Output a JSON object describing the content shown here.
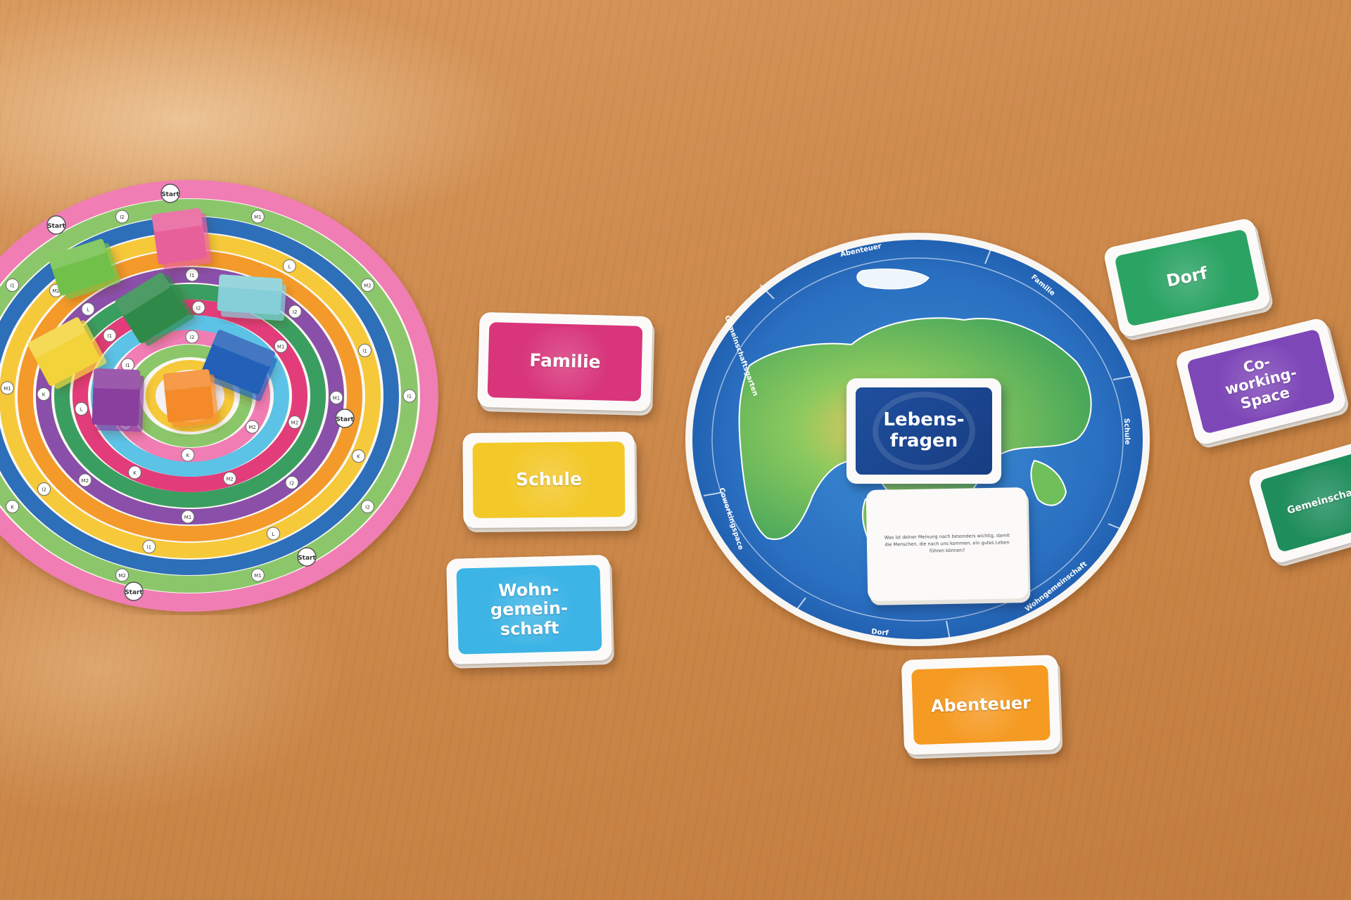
{
  "spiral_board": {
    "start_label": "Start",
    "field_labels": [
      "I1",
      "I2",
      "M1",
      "M2",
      "K",
      "L"
    ],
    "colors": [
      "#f07db3",
      "#8bc76a",
      "#2d6fb8",
      "#f6c93a",
      "#f39a2a",
      "#8a4fa8",
      "#3b9e61",
      "#e23d7a",
      "#5cc3e6"
    ]
  },
  "blocks": [
    {
      "name": "pink-block",
      "color": "#e8609a"
    },
    {
      "name": "green-block",
      "color": "#71c04a"
    },
    {
      "name": "teal-block",
      "color": "#86cfd8"
    },
    {
      "name": "darkgreen-block",
      "color": "#2f8a4a"
    },
    {
      "name": "yellow-block",
      "color": "#f2d43a"
    },
    {
      "name": "blue-block",
      "color": "#2360b8"
    },
    {
      "name": "purple-block",
      "color": "#8a3e9e"
    },
    {
      "name": "orange-block",
      "color": "#f48a2a"
    }
  ],
  "decks": {
    "familie": {
      "label": "Familie",
      "color": "#d8357b"
    },
    "schule": {
      "label": "Schule",
      "color": "#f3c829"
    },
    "wohngemeinschaft": {
      "label": "Wohn-\ngemein-\nschaft",
      "color": "#3cb4e6"
    },
    "dorf": {
      "label": "Dorf",
      "color": "#2aa363"
    },
    "coworking": {
      "label": "Co-\nworking-\nSpace",
      "color": "#7e47b8"
    },
    "gemeinschaft": {
      "label": "Gemeinschaft",
      "color": "#1f8d5c"
    },
    "abenteuer": {
      "label": "Abenteuer",
      "color": "#f59a22"
    }
  },
  "globe_board": {
    "segment_labels": {
      "abenteuer": "Abenteuer",
      "familie": "Familie",
      "gemeinschaftsgarten": "Gemeinschaftsgarten",
      "schule": "Schule",
      "coworkingspace": "Coworkingspace",
      "wohngemeinschaft": "Wohngemeinschaft",
      "dorf": "Dorf"
    },
    "center_card": "Lebens-\nfragen",
    "question_card": "Was ist deiner Meinung nach besonders wichtig, damit die Menschen, die nach uns kommen, ein gutes Leben führen können?"
  }
}
